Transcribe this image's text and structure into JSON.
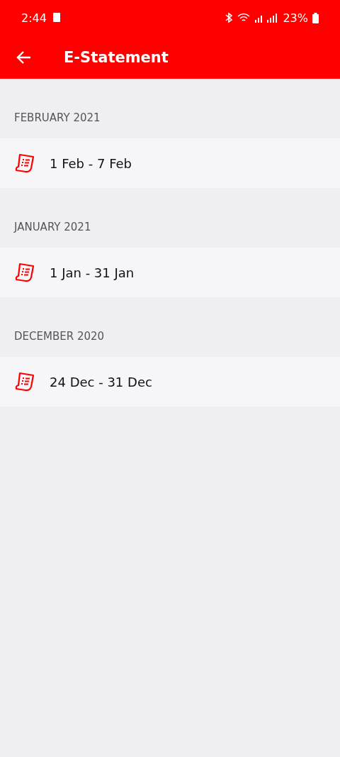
{
  "status_bar": {
    "time": "2:44",
    "battery": "23%"
  },
  "app_bar": {
    "title": "E-Statement"
  },
  "sections": [
    {
      "heading": "FEBRUARY 2021",
      "items": [
        {
          "label": "1 Feb - 7 Feb"
        }
      ]
    },
    {
      "heading": "JANUARY 2021",
      "items": [
        {
          "label": "1 Jan - 31 Jan"
        }
      ]
    },
    {
      "heading": "DECEMBER 2020",
      "items": [
        {
          "label": "24 Dec - 31 Dec"
        }
      ]
    }
  ]
}
